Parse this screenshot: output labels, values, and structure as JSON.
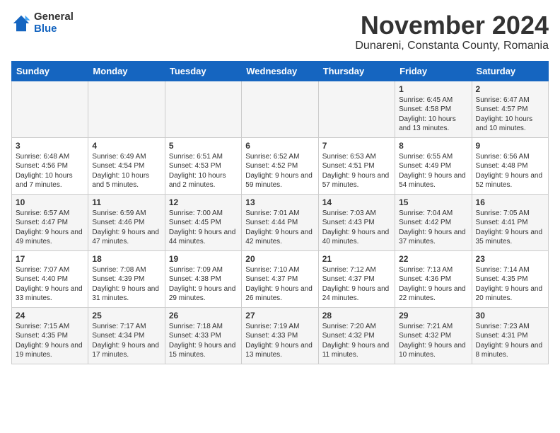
{
  "header": {
    "logo_general": "General",
    "logo_blue": "Blue",
    "month_title": "November 2024",
    "location": "Dunareni, Constanta County, Romania"
  },
  "columns": [
    "Sunday",
    "Monday",
    "Tuesday",
    "Wednesday",
    "Thursday",
    "Friday",
    "Saturday"
  ],
  "weeks": [
    [
      {
        "day": "",
        "info": ""
      },
      {
        "day": "",
        "info": ""
      },
      {
        "day": "",
        "info": ""
      },
      {
        "day": "",
        "info": ""
      },
      {
        "day": "",
        "info": ""
      },
      {
        "day": "1",
        "info": "Sunrise: 6:45 AM\nSunset: 4:58 PM\nDaylight: 10 hours and 13 minutes."
      },
      {
        "day": "2",
        "info": "Sunrise: 6:47 AM\nSunset: 4:57 PM\nDaylight: 10 hours and 10 minutes."
      }
    ],
    [
      {
        "day": "3",
        "info": "Sunrise: 6:48 AM\nSunset: 4:56 PM\nDaylight: 10 hours and 7 minutes."
      },
      {
        "day": "4",
        "info": "Sunrise: 6:49 AM\nSunset: 4:54 PM\nDaylight: 10 hours and 5 minutes."
      },
      {
        "day": "5",
        "info": "Sunrise: 6:51 AM\nSunset: 4:53 PM\nDaylight: 10 hours and 2 minutes."
      },
      {
        "day": "6",
        "info": "Sunrise: 6:52 AM\nSunset: 4:52 PM\nDaylight: 9 hours and 59 minutes."
      },
      {
        "day": "7",
        "info": "Sunrise: 6:53 AM\nSunset: 4:51 PM\nDaylight: 9 hours and 57 minutes."
      },
      {
        "day": "8",
        "info": "Sunrise: 6:55 AM\nSunset: 4:49 PM\nDaylight: 9 hours and 54 minutes."
      },
      {
        "day": "9",
        "info": "Sunrise: 6:56 AM\nSunset: 4:48 PM\nDaylight: 9 hours and 52 minutes."
      }
    ],
    [
      {
        "day": "10",
        "info": "Sunrise: 6:57 AM\nSunset: 4:47 PM\nDaylight: 9 hours and 49 minutes."
      },
      {
        "day": "11",
        "info": "Sunrise: 6:59 AM\nSunset: 4:46 PM\nDaylight: 9 hours and 47 minutes."
      },
      {
        "day": "12",
        "info": "Sunrise: 7:00 AM\nSunset: 4:45 PM\nDaylight: 9 hours and 44 minutes."
      },
      {
        "day": "13",
        "info": "Sunrise: 7:01 AM\nSunset: 4:44 PM\nDaylight: 9 hours and 42 minutes."
      },
      {
        "day": "14",
        "info": "Sunrise: 7:03 AM\nSunset: 4:43 PM\nDaylight: 9 hours and 40 minutes."
      },
      {
        "day": "15",
        "info": "Sunrise: 7:04 AM\nSunset: 4:42 PM\nDaylight: 9 hours and 37 minutes."
      },
      {
        "day": "16",
        "info": "Sunrise: 7:05 AM\nSunset: 4:41 PM\nDaylight: 9 hours and 35 minutes."
      }
    ],
    [
      {
        "day": "17",
        "info": "Sunrise: 7:07 AM\nSunset: 4:40 PM\nDaylight: 9 hours and 33 minutes."
      },
      {
        "day": "18",
        "info": "Sunrise: 7:08 AM\nSunset: 4:39 PM\nDaylight: 9 hours and 31 minutes."
      },
      {
        "day": "19",
        "info": "Sunrise: 7:09 AM\nSunset: 4:38 PM\nDaylight: 9 hours and 29 minutes."
      },
      {
        "day": "20",
        "info": "Sunrise: 7:10 AM\nSunset: 4:37 PM\nDaylight: 9 hours and 26 minutes."
      },
      {
        "day": "21",
        "info": "Sunrise: 7:12 AM\nSunset: 4:37 PM\nDaylight: 9 hours and 24 minutes."
      },
      {
        "day": "22",
        "info": "Sunrise: 7:13 AM\nSunset: 4:36 PM\nDaylight: 9 hours and 22 minutes."
      },
      {
        "day": "23",
        "info": "Sunrise: 7:14 AM\nSunset: 4:35 PM\nDaylight: 9 hours and 20 minutes."
      }
    ],
    [
      {
        "day": "24",
        "info": "Sunrise: 7:15 AM\nSunset: 4:35 PM\nDaylight: 9 hours and 19 minutes."
      },
      {
        "day": "25",
        "info": "Sunrise: 7:17 AM\nSunset: 4:34 PM\nDaylight: 9 hours and 17 minutes."
      },
      {
        "day": "26",
        "info": "Sunrise: 7:18 AM\nSunset: 4:33 PM\nDaylight: 9 hours and 15 minutes."
      },
      {
        "day": "27",
        "info": "Sunrise: 7:19 AM\nSunset: 4:33 PM\nDaylight: 9 hours and 13 minutes."
      },
      {
        "day": "28",
        "info": "Sunrise: 7:20 AM\nSunset: 4:32 PM\nDaylight: 9 hours and 11 minutes."
      },
      {
        "day": "29",
        "info": "Sunrise: 7:21 AM\nSunset: 4:32 PM\nDaylight: 9 hours and 10 minutes."
      },
      {
        "day": "30",
        "info": "Sunrise: 7:23 AM\nSunset: 4:31 PM\nDaylight: 9 hours and 8 minutes."
      }
    ]
  ]
}
